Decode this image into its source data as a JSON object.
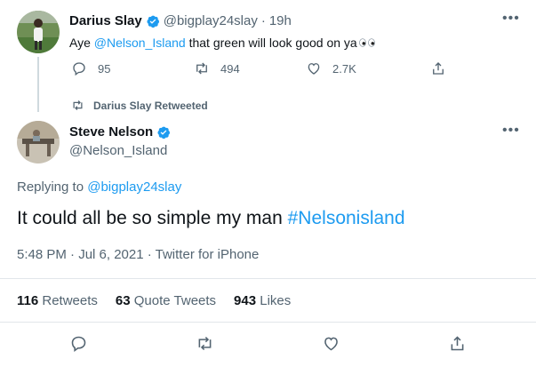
{
  "first_tweet": {
    "author_name": "Darius Slay",
    "handle": "@bigplay24slay",
    "separator": "·",
    "time": "19h",
    "text_prefix": "Aye ",
    "mention": "@Nelson_Island",
    "text_suffix": " that green will look good on ya",
    "emoji": "eyes",
    "replies": "95",
    "retweets": "494",
    "likes": "2.7K"
  },
  "retweet_banner": {
    "label": "Darius Slay Retweeted"
  },
  "main_tweet": {
    "author_name": "Steve Nelson",
    "handle": "@Nelson_Island",
    "replying_to_label": "Replying to ",
    "replying_to_handle": "@bigplay24slay",
    "text_prefix": "It could all be so simple my man ",
    "hashtag": "#Nelsonisland",
    "timestamp": "5:48 PM · Jul 6, 2021 · Twitter for iPhone",
    "stats": {
      "retweets_count": "116",
      "retweets_label": "Retweets",
      "quote_count": "63",
      "quote_label": "Quote Tweets",
      "likes_count": "943",
      "likes_label": "Likes"
    }
  },
  "colors": {
    "accent": "#1d9bf0",
    "muted": "#536471",
    "divider": "#e1e6ea"
  },
  "icons": [
    "verified-badge-icon",
    "more-icon",
    "reply-icon",
    "retweet-icon",
    "like-icon",
    "share-icon"
  ]
}
